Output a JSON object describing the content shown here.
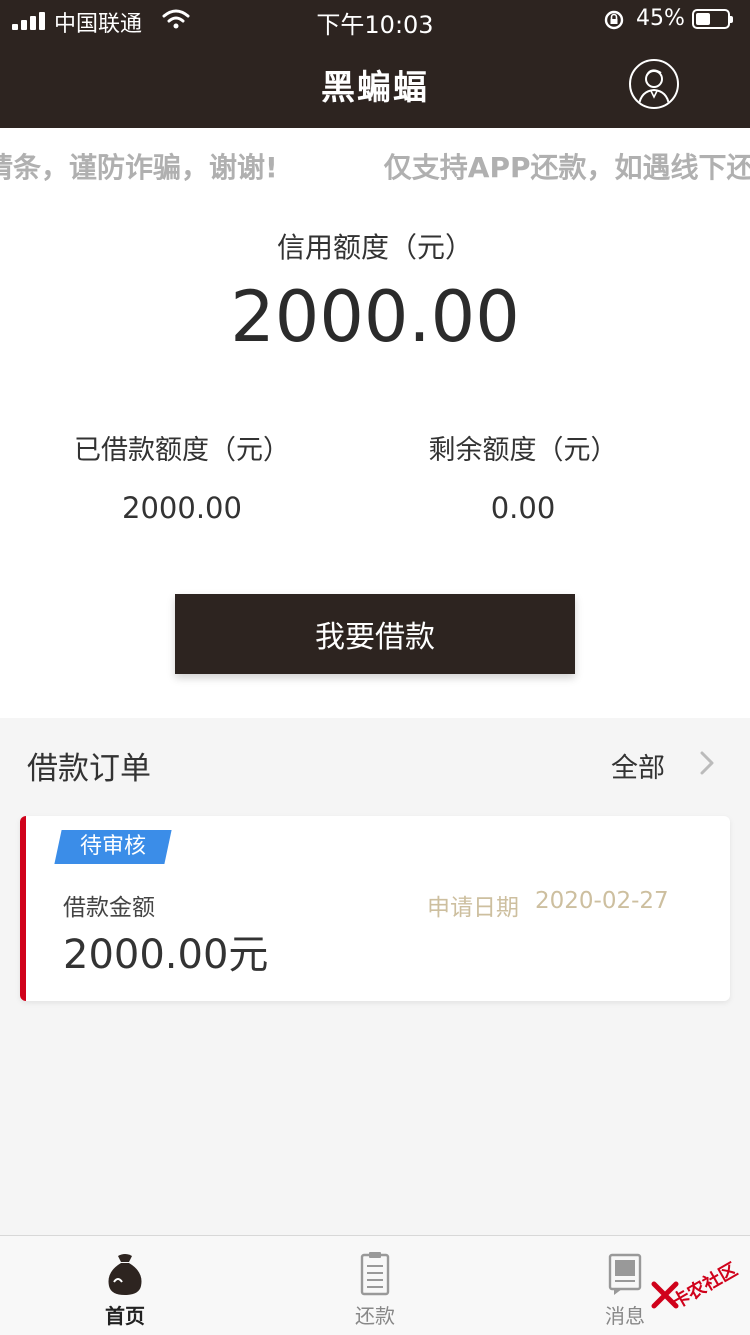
{
  "status_bar": {
    "carrier": "中国联通",
    "time": "下午10:03",
    "battery_percent": "45%",
    "battery_level": 0.45
  },
  "nav": {
    "title": "黑蝙蝠",
    "profile_icon": "user-avatar-icon"
  },
  "marquee": {
    "items": [
      "请条，谨防诈骗，谢谢!",
      "仅支持APP还款，如遇线下还"
    ]
  },
  "credit": {
    "label": "信用额度（元）",
    "value": "2000.00"
  },
  "borrowed": {
    "label": "已借款额度（元）",
    "value": "2000.00"
  },
  "remaining": {
    "label": "剩余额度（元）",
    "value": "0.00"
  },
  "borrow_button": {
    "label": "我要借款"
  },
  "orders": {
    "title": "借款订单",
    "all_label": "全部",
    "items": [
      {
        "status": "待审核",
        "amount_label": "借款金额",
        "amount": "2000.00元",
        "date_label": "申请日期",
        "date": "2020-02-27"
      }
    ]
  },
  "tabs": [
    {
      "label": "首页",
      "icon": "money-bag-icon",
      "active": true
    },
    {
      "label": "还款",
      "icon": "clipboard-icon",
      "active": false
    },
    {
      "label": "消息",
      "icon": "message-icon",
      "active": false
    }
  ],
  "watermark": {
    "text": "卡农社区"
  },
  "colors": {
    "primary_dark": "#2d2420",
    "status_badge": "#3b8de8",
    "order_accent": "#d0021b",
    "date_text": "#cdbf9f"
  }
}
